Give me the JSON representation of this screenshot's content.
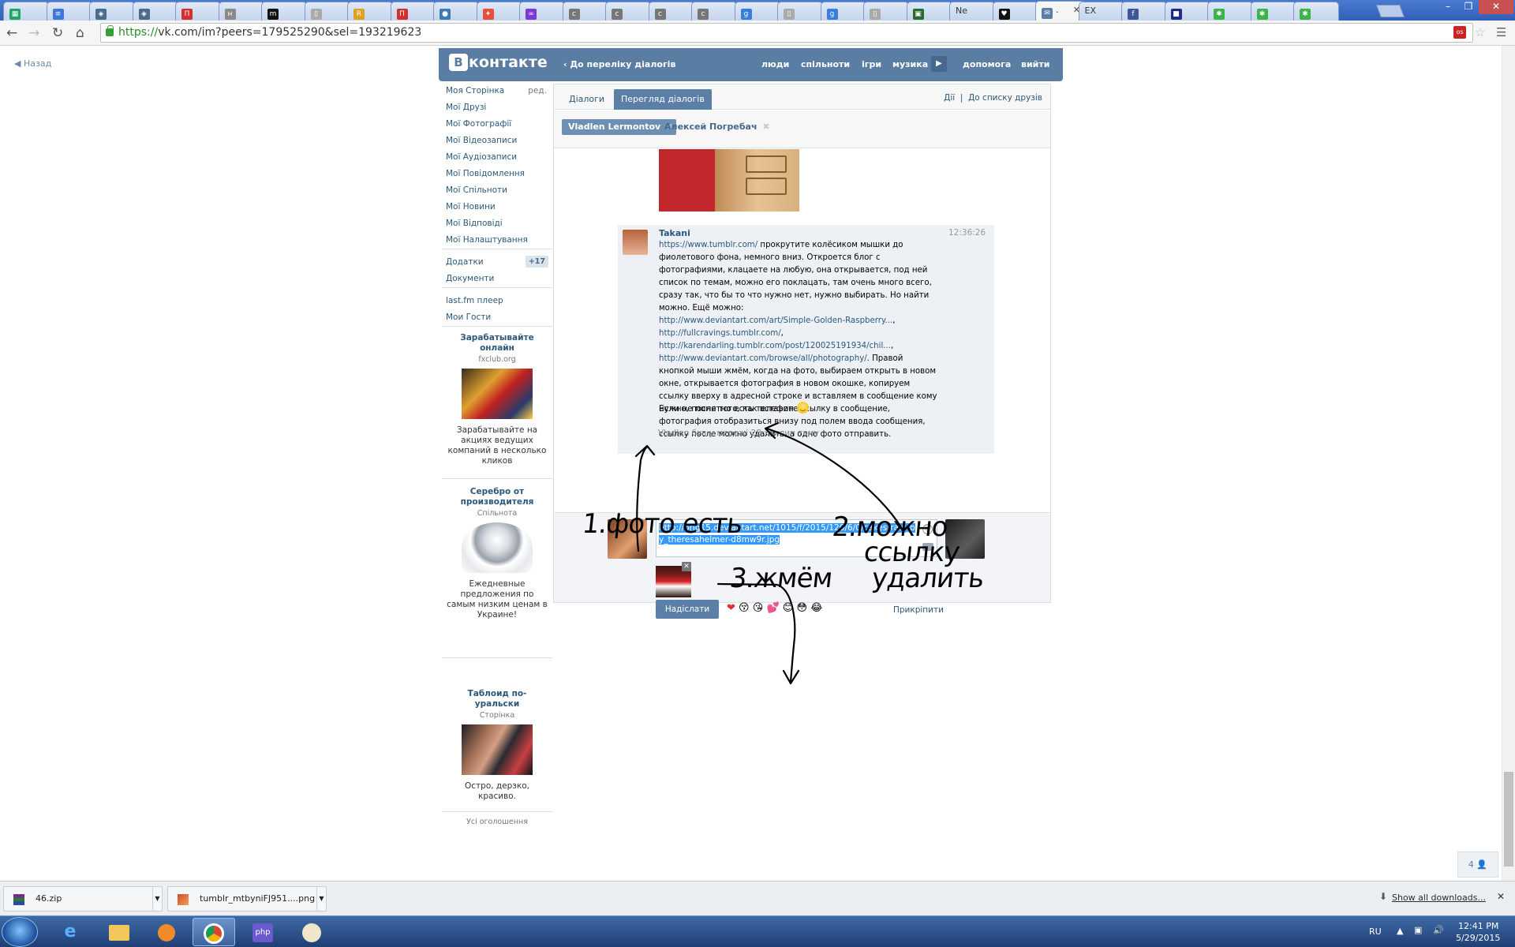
{
  "browser": {
    "tabs": [
      {
        "label": "",
        "icon": "sheets-icon",
        "color": "#21a464"
      },
      {
        "label": "",
        "icon": "docs-icon",
        "color": "#3c78d8"
      },
      {
        "label": "",
        "icon": "shield-icon",
        "color": "#4a6b8a"
      },
      {
        "label": "",
        "icon": "shield-icon",
        "color": "#4a6b8a"
      },
      {
        "label": "",
        "icon": "p-icon",
        "color": "#d22f2f"
      },
      {
        "label": "",
        "icon": "n-icon",
        "color": "#8a8a8a"
      },
      {
        "label": "",
        "icon": "m-icon",
        "color": "#111111"
      },
      {
        "label": "",
        "icon": "page-icon",
        "color": "#aaaaaa"
      },
      {
        "label": "",
        "icon": "rma-icon",
        "color": "#e0a020"
      },
      {
        "label": "",
        "icon": "p-icon",
        "color": "#d22f2f"
      },
      {
        "label": "",
        "icon": "globe-icon",
        "color": "#3d7ab8"
      },
      {
        "label": "",
        "icon": "pinwheel-icon",
        "color": "#e84d3d"
      },
      {
        "label": "",
        "icon": "swirl-icon",
        "color": "#7a3ad8"
      },
      {
        "label": "",
        "icon": "c-icon",
        "color": "#777777"
      },
      {
        "label": "",
        "icon": "c-icon",
        "color": "#777777"
      },
      {
        "label": "",
        "icon": "c-icon",
        "color": "#777777"
      },
      {
        "label": "",
        "icon": "c-icon",
        "color": "#777777"
      },
      {
        "label": "",
        "icon": "google-icon",
        "color": "#3b7ddd"
      },
      {
        "label": "",
        "icon": "page-icon",
        "color": "#aaaaaa"
      },
      {
        "label": "",
        "icon": "google-icon",
        "color": "#3b7ddd"
      },
      {
        "label": "",
        "icon": "page-icon",
        "color": "#aaaaaa"
      },
      {
        "label": "",
        "icon": "stm-icon",
        "color": "#2a6a2a"
      },
      {
        "label": "Ne",
        "icon": "",
        "color": ""
      },
      {
        "label": "",
        "icon": "heart-icon",
        "color": "#111111"
      },
      {
        "label": ".",
        "icon": "vk-message-icon",
        "color": "#5b7fa6",
        "active": true
      },
      {
        "label": "EX",
        "icon": "",
        "color": ""
      },
      {
        "label": "",
        "icon": "facebook-icon",
        "color": "#3b5998"
      },
      {
        "label": "",
        "icon": "square-icon",
        "color": "#1d2d8a"
      },
      {
        "label": "",
        "icon": "puzzle-icon",
        "color": "#3bb54a"
      },
      {
        "label": "",
        "icon": "puzzle-icon",
        "color": "#3bb54a"
      },
      {
        "label": "",
        "icon": "puzzle-icon",
        "color": "#3bb54a"
      }
    ],
    "url_scheme": "https://",
    "url_rest": "vk.com/im?peers=179525290&sel=193219623"
  },
  "page": {
    "back_label": "Назад",
    "header": {
      "logo_text": "контакте",
      "logo_letter": "В",
      "back_link": "До переліку діалогів",
      "nav": [
        "люди",
        "спільноти",
        "ігри",
        "музика",
        "допомога",
        "вийти"
      ]
    },
    "left_menu": {
      "items": [
        {
          "label": "Моя Сторінка",
          "aux": "ред."
        },
        {
          "label": "Мої Друзі"
        },
        {
          "label": "Мої Фотографії"
        },
        {
          "label": "Мої Відеозаписи"
        },
        {
          "label": "Мої Аудіозаписи"
        },
        {
          "label": "Мої Повідомлення"
        },
        {
          "label": "Мої Спільноти"
        },
        {
          "label": "Мої Новини"
        },
        {
          "label": "Мої Відповіді"
        },
        {
          "label": "Мої Налаштування"
        }
      ],
      "apps": [
        {
          "label": "Додатки",
          "count": "+17"
        },
        {
          "label": "Документи"
        }
      ],
      "extra": [
        {
          "label": "last.fm плеер"
        },
        {
          "label": "Мои Гости"
        }
      ],
      "ads": [
        {
          "title": "Зарабатывайте онлайн",
          "domain": "fxclub.org",
          "text": "Зарабатывайте на акциях ведущих компаний в несколько кликов"
        },
        {
          "title": "Серебро от производителя",
          "domain": "Спільнота",
          "text": "Ежедневные предложения по самым низким ценам в Украине!"
        },
        {
          "title": "Таблоид по-уральски",
          "domain": "Сторінка",
          "text": "Остро, дерзко, красиво."
        }
      ],
      "all_ads": "Усі оголошення"
    },
    "im": {
      "tabs": [
        "Діалоги",
        "Перегляд діалогів"
      ],
      "actions": [
        "Дії",
        "До списку друзів"
      ],
      "peers": [
        "Vladlen Lermontov",
        "Алексей Погребач"
      ],
      "message": {
        "author": "Takani",
        "time": "12:36:26",
        "link1": "https://www.tumblr.com/",
        "text1": " прокрутите колёсиком мышки до фиолетового фона, немного вниз. Откроется блог с фотографиями, клацаете на любую, она открывается, под ней список по темам, можно его поклацать, там очень много всего, сразу так, что бы то что нужно нет, нужно выбирать. Но найти можно. Ещё можно: ",
        "link2": "http://www.deviantart.com/art/Simple-Golden-Raspberry...",
        "link3": "http://fullcravings.tumblr.com/",
        "link4": "http://karendarling.tumblr.com/post/120025191934/chil...",
        "link5": "http://www.deviantart.com/browse/all/photography/",
        "text2": ". Правой кнопкой мыши жмём, когда на фото, выбираем открыть в новом окне, открывается фотография в новом окошке, копируем ссылку вверху в адресной строке и вставляем в сообщение кому нужно, после того, как вставите ссылку в сообщение, фотография отобразиться внизу под полем ввода сообщения, ссылку после можно удалить, а одно фото отправить.",
        "last_line": "Если не понятно есть телефон"
      },
      "online_status": "Vladlen був у мережі 28 хвилин тому",
      "composer": {
        "input_value": "http://orig15.deviantart.net/1015/f/2015/120/6/0/cakestraw_by_theresahelmer-d8mw9r.jpg",
        "send_label": "Надіслати",
        "attach_label": "Прикріпити",
        "emojis": [
          "❤",
          "😚",
          "😘",
          "💕",
          "😊",
          "😳",
          "😂"
        ]
      }
    },
    "annotations": [
      "1.фото есть",
      "2.можно",
      "ссылку",
      "удалить",
      "3.жмём"
    ],
    "online_counter": "4"
  },
  "downloads": {
    "items": [
      "46.zip",
      "tumblr_mtbyniFJ951....png"
    ],
    "show_all": "Show all downloads..."
  },
  "taskbar": {
    "lang": "RU",
    "time": "12:41 PM",
    "date": "5/29/2015"
  }
}
